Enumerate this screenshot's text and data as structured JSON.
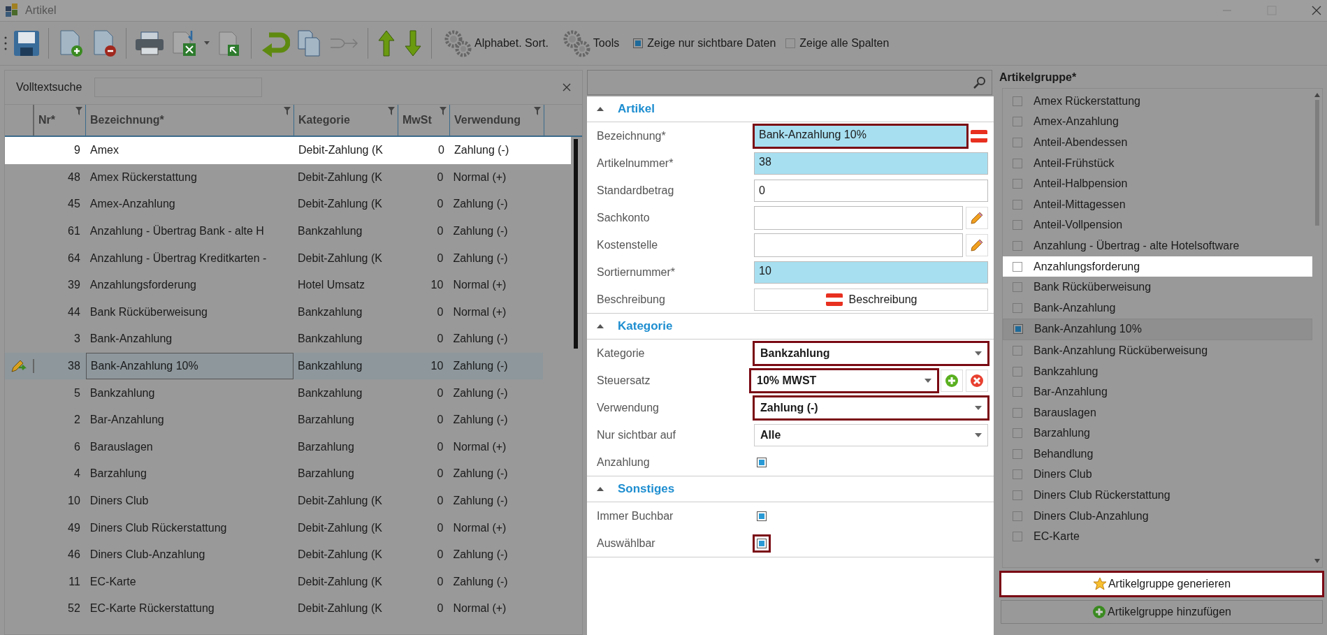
{
  "window": {
    "title": "Artikel"
  },
  "toolbar": {
    "text_buttons": [
      "Alphabet. Sort.",
      "Tools"
    ],
    "checks": [
      {
        "label": "Zeige nur sichtbare Daten",
        "checked": true
      },
      {
        "label": "Zeige alle Spalten",
        "checked": false
      }
    ]
  },
  "search": {
    "label": "Volltextsuche"
  },
  "table": {
    "columns": [
      "Nr*",
      "Bezeichnung*",
      "Kategorie",
      "MwSt",
      "Verwendung"
    ],
    "rows": [
      {
        "cells": [
          "9",
          "Amex",
          "Debit-Zahlung (K",
          "0",
          "Zahlung (-)"
        ],
        "spotlit": true,
        "selected": false
      },
      {
        "cells": [
          "48",
          "Amex Rückerstattung",
          "Debit-Zahlung (K",
          "0",
          "Normal (+)"
        ],
        "spotlit": false,
        "selected": false
      },
      {
        "cells": [
          "45",
          "Amex-Anzahlung",
          "Debit-Zahlung (K",
          "0",
          "Zahlung (-)"
        ],
        "spotlit": false,
        "selected": false
      },
      {
        "cells": [
          "61",
          "Anzahlung - Übertrag Bank - alte H",
          "Bankzahlung",
          "0",
          "Zahlung (-)"
        ],
        "spotlit": false,
        "selected": false
      },
      {
        "cells": [
          "64",
          "Anzahlung - Übertrag Kreditkarten -",
          "Debit-Zahlung (K",
          "0",
          "Zahlung (-)"
        ],
        "spotlit": false,
        "selected": false
      },
      {
        "cells": [
          "39",
          "Anzahlungsforderung",
          "Hotel Umsatz",
          "10",
          "Normal (+)"
        ],
        "spotlit": false,
        "selected": false
      },
      {
        "cells": [
          "44",
          "Bank Rücküberweisung",
          "Bankzahlung",
          "0",
          "Normal (+)"
        ],
        "spotlit": false,
        "selected": false
      },
      {
        "cells": [
          "3",
          "Bank-Anzahlung",
          "Bankzahlung",
          "0",
          "Zahlung (-)"
        ],
        "spotlit": false,
        "selected": false
      },
      {
        "cells": [
          "38",
          "Bank-Anzahlung 10%",
          "Bankzahlung",
          "10",
          "Zahlung (-)"
        ],
        "spotlit": false,
        "selected": true
      },
      {
        "cells": [
          "5",
          "Bankzahlung",
          "Bankzahlung",
          "0",
          "Zahlung (-)"
        ],
        "spotlit": false,
        "selected": false
      },
      {
        "cells": [
          "2",
          "Bar-Anzahlung",
          "Barzahlung",
          "0",
          "Zahlung (-)"
        ],
        "spotlit": false,
        "selected": false
      },
      {
        "cells": [
          "6",
          "Barauslagen",
          "Barzahlung",
          "0",
          "Normal (+)"
        ],
        "spotlit": false,
        "selected": false
      },
      {
        "cells": [
          "4",
          "Barzahlung",
          "Barzahlung",
          "0",
          "Zahlung (-)"
        ],
        "spotlit": false,
        "selected": false
      },
      {
        "cells": [
          "10",
          "Diners Club",
          "Debit-Zahlung (K",
          "0",
          "Zahlung (-)"
        ],
        "spotlit": false,
        "selected": false
      },
      {
        "cells": [
          "49",
          "Diners Club Rückerstattung",
          "Debit-Zahlung (K",
          "0",
          "Normal (+)"
        ],
        "spotlit": false,
        "selected": false
      },
      {
        "cells": [
          "46",
          "Diners Club-Anzahlung",
          "Debit-Zahlung (K",
          "0",
          "Zahlung (-)"
        ],
        "spotlit": false,
        "selected": false
      },
      {
        "cells": [
          "11",
          "EC-Karte",
          "Debit-Zahlung (K",
          "0",
          "Zahlung (-)"
        ],
        "spotlit": false,
        "selected": false
      },
      {
        "cells": [
          "52",
          "EC-Karte Rückerstattung",
          "Debit-Zahlung (K",
          "0",
          "Normal (+)"
        ],
        "spotlit": false,
        "selected": false
      }
    ]
  },
  "form": {
    "sections": [
      {
        "title": "Artikel",
        "expanded": true,
        "fields": [
          {
            "kind": "translatable",
            "label": "Bezeichnung*",
            "value": "Bank-Anzahlung 10%",
            "required": true,
            "framed": true
          },
          {
            "kind": "text",
            "label": "Artikelnummer*",
            "value": "38",
            "required": true,
            "framed": false
          },
          {
            "kind": "text",
            "label": "Standardbetrag",
            "value": "0",
            "required": false,
            "framed": false
          },
          {
            "kind": "lookup",
            "label": "Sachkonto",
            "framed": false
          },
          {
            "kind": "lookup",
            "label": "Kostenstelle",
            "framed": false
          },
          {
            "kind": "text",
            "label": "Sortiernummer*",
            "value": "10",
            "required": true,
            "framed": false
          },
          {
            "kind": "button",
            "label": "Beschreibung",
            "value": "Beschreibung",
            "framed": false
          }
        ]
      },
      {
        "title": "Kategorie",
        "expanded": true,
        "fields": [
          {
            "kind": "select",
            "label": "Kategorie",
            "value": "Bankzahlung",
            "framed": true
          },
          {
            "kind": "tax",
            "label": "Steuersatz",
            "value": "10% MWST",
            "framed": true
          },
          {
            "kind": "select",
            "label": "Verwendung",
            "value": "Zahlung (-)",
            "framed": true
          },
          {
            "kind": "select",
            "label": "Nur sichtbar auf",
            "value": "Alle",
            "framed": false
          },
          {
            "kind": "checkbox",
            "label": "Anzahlung",
            "checked": true,
            "framed": false
          }
        ]
      },
      {
        "title": "Sonstiges",
        "expanded": true,
        "fields": [
          {
            "kind": "checkbox",
            "label": "Immer Buchbar",
            "checked": true,
            "framed": false
          },
          {
            "kind": "checkbox",
            "label": "Auswählbar",
            "checked": true,
            "framed": true
          }
        ]
      }
    ]
  },
  "groups": {
    "title": "Artikelgruppe*",
    "items": [
      {
        "label": "Amex Rückerstattung",
        "checked": false,
        "spotlit": false
      },
      {
        "label": "Amex-Anzahlung",
        "checked": false,
        "spotlit": false
      },
      {
        "label": "Anteil-Abendessen",
        "checked": false,
        "spotlit": false
      },
      {
        "label": "Anteil-Frühstück",
        "checked": false,
        "spotlit": false
      },
      {
        "label": "Anteil-Halbpension",
        "checked": false,
        "spotlit": false
      },
      {
        "label": "Anteil-Mittagessen",
        "checked": false,
        "spotlit": false
      },
      {
        "label": "Anteil-Vollpension",
        "checked": false,
        "spotlit": false
      },
      {
        "label": "Anzahlung - Übertrag - alte Hotelsoftware",
        "checked": false,
        "spotlit": false
      },
      {
        "label": "Anzahlungsforderung",
        "checked": false,
        "spotlit": true
      },
      {
        "label": "Bank Rücküberweisung",
        "checked": false,
        "spotlit": false
      },
      {
        "label": "Bank-Anzahlung",
        "checked": false,
        "spotlit": false
      },
      {
        "label": "Bank-Anzahlung 10%",
        "checked": true,
        "spotlit": false
      },
      {
        "label": "Bank-Anzahlung Rücküberweisung",
        "checked": false,
        "spotlit": false
      },
      {
        "label": "Bankzahlung",
        "checked": false,
        "spotlit": false
      },
      {
        "label": "Bar-Anzahlung",
        "checked": false,
        "spotlit": false
      },
      {
        "label": "Barauslagen",
        "checked": false,
        "spotlit": false
      },
      {
        "label": "Barzahlung",
        "checked": false,
        "spotlit": false
      },
      {
        "label": "Behandlung",
        "checked": false,
        "spotlit": false
      },
      {
        "label": "Diners Club",
        "checked": false,
        "spotlit": false
      },
      {
        "label": "Diners Club Rückerstattung",
        "checked": false,
        "spotlit": false
      },
      {
        "label": "Diners Club-Anzahlung",
        "checked": false,
        "spotlit": false
      },
      {
        "label": "EC-Karte",
        "checked": false,
        "spotlit": false
      }
    ],
    "buttons": [
      {
        "kind": "generate",
        "label": "Artikelgruppe generieren",
        "framed": true
      },
      {
        "kind": "add",
        "label": "Artikelgruppe hinzufügen",
        "framed": false
      }
    ]
  }
}
